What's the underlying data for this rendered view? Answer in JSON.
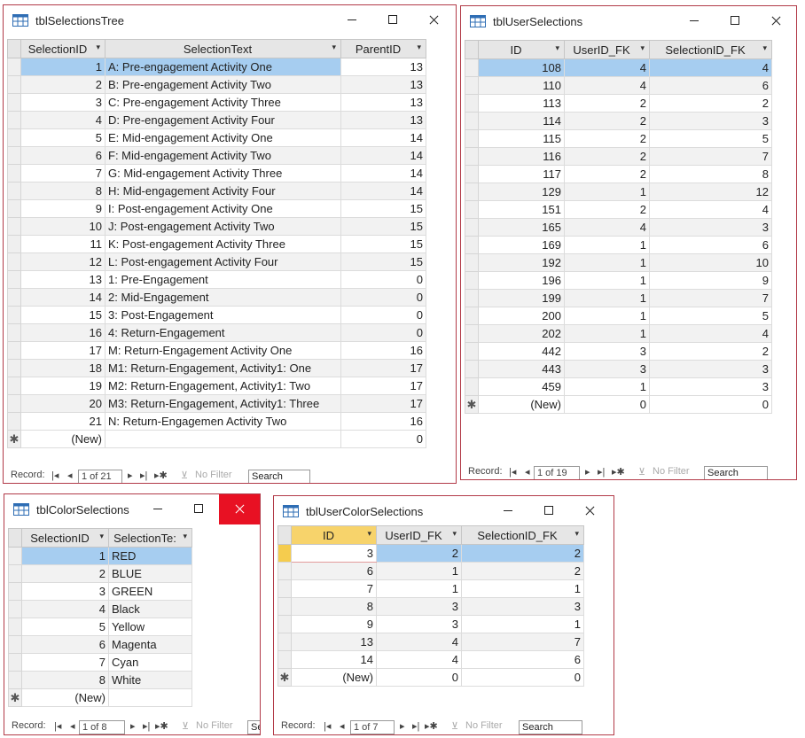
{
  "windows": {
    "selections_tree": {
      "title": "tblSelectionsTree",
      "columns": [
        "SelectionID",
        "SelectionText",
        "ParentID"
      ],
      "rows": [
        [
          1,
          "A: Pre-engagement Activity One",
          13
        ],
        [
          2,
          "B: Pre-engagement Activity Two",
          13
        ],
        [
          3,
          "C: Pre-engagement Activity Three",
          13
        ],
        [
          4,
          "D: Pre-engagement Activity Four",
          13
        ],
        [
          5,
          "E: Mid-engagement Activity One",
          14
        ],
        [
          6,
          "F: Mid-engagement Activity Two",
          14
        ],
        [
          7,
          "G: Mid-engagement Activity Three",
          14
        ],
        [
          8,
          "H: Mid-engagement Activity Four",
          14
        ],
        [
          9,
          "I: Post-engagement Activity One",
          15
        ],
        [
          10,
          "J: Post-engagement Activity Two",
          15
        ],
        [
          11,
          "K: Post-engagement Activity Three",
          15
        ],
        [
          12,
          "L: Post-engagement Activity Four",
          15
        ],
        [
          13,
          "1: Pre-Engagement",
          0
        ],
        [
          14,
          "2: Mid-Engagement",
          0
        ],
        [
          15,
          "3: Post-Engagement",
          0
        ],
        [
          16,
          "4: Return-Engagement",
          0
        ],
        [
          17,
          "M: Return-Engagement Activity One",
          16
        ],
        [
          18,
          "M1: Return-Engagement, Activity1: One",
          17
        ],
        [
          19,
          "M2: Return-Engagement, Activity1: Two",
          17
        ],
        [
          20,
          "M3: Return-Engagement, Activity1: Three",
          17
        ],
        [
          21,
          "N: Return-Engagemen Activity Two",
          16
        ]
      ],
      "new_row": [
        "(New)",
        "",
        "0"
      ],
      "record_label": "Record:",
      "record_value": "1 of 21",
      "no_filter": "No Filter",
      "search": "Search"
    },
    "user_selections": {
      "title": "tblUserSelections",
      "columns": [
        "ID",
        "UserID_FK",
        "SelectionID_FK"
      ],
      "rows": [
        [
          108,
          4,
          4
        ],
        [
          110,
          4,
          6
        ],
        [
          113,
          2,
          2
        ],
        [
          114,
          2,
          3
        ],
        [
          115,
          2,
          5
        ],
        [
          116,
          2,
          7
        ],
        [
          117,
          2,
          8
        ],
        [
          129,
          1,
          12
        ],
        [
          151,
          2,
          4
        ],
        [
          165,
          4,
          3
        ],
        [
          169,
          1,
          6
        ],
        [
          192,
          1,
          10
        ],
        [
          196,
          1,
          9
        ],
        [
          199,
          1,
          7
        ],
        [
          200,
          1,
          5
        ],
        [
          202,
          1,
          4
        ],
        [
          442,
          3,
          2
        ],
        [
          443,
          3,
          3
        ],
        [
          459,
          1,
          3
        ]
      ],
      "new_row": [
        "(New)",
        "0",
        "0"
      ],
      "record_label": "Record:",
      "record_value": "1 of 19",
      "no_filter": "No Filter",
      "search": "Search"
    },
    "color_selections": {
      "title": "tblColorSelections",
      "columns": [
        "SelectionID",
        "SelectionTe:"
      ],
      "rows": [
        [
          1,
          "RED"
        ],
        [
          2,
          "BLUE"
        ],
        [
          3,
          "GREEN"
        ],
        [
          4,
          "Black"
        ],
        [
          5,
          "Yellow"
        ],
        [
          6,
          "Magenta"
        ],
        [
          7,
          "Cyan"
        ],
        [
          8,
          "White"
        ]
      ],
      "new_row": [
        "(New)",
        ""
      ],
      "record_label": "Record:",
      "record_value": "1 of 8",
      "no_filter": "No Filter",
      "search": "Se"
    },
    "user_color_selections": {
      "title": "tblUserColorSelections",
      "columns": [
        "ID",
        "UserID_FK",
        "SelectionID_FK"
      ],
      "rows": [
        [
          3,
          2,
          2
        ],
        [
          6,
          1,
          2
        ],
        [
          7,
          1,
          1
        ],
        [
          8,
          3,
          3
        ],
        [
          9,
          3,
          1
        ],
        [
          13,
          4,
          7
        ],
        [
          14,
          4,
          6
        ]
      ],
      "new_row": [
        "(New)",
        "0",
        "0"
      ],
      "record_label": "Record:",
      "record_value": "1 of 7",
      "no_filter": "No Filter",
      "search": "Search"
    }
  },
  "glyphs": {
    "dropdown": "▾",
    "new_record": "✱",
    "nav_first": "|◂",
    "nav_prev": "◂",
    "nav_next": "▸",
    "nav_last": "▸|",
    "nav_new": "▸✱"
  },
  "colors": {
    "window_border": "#b23a48",
    "selection_highlight": "#a6cdf0",
    "current_record": "#f5cc4e",
    "close_active": "#e81123"
  }
}
